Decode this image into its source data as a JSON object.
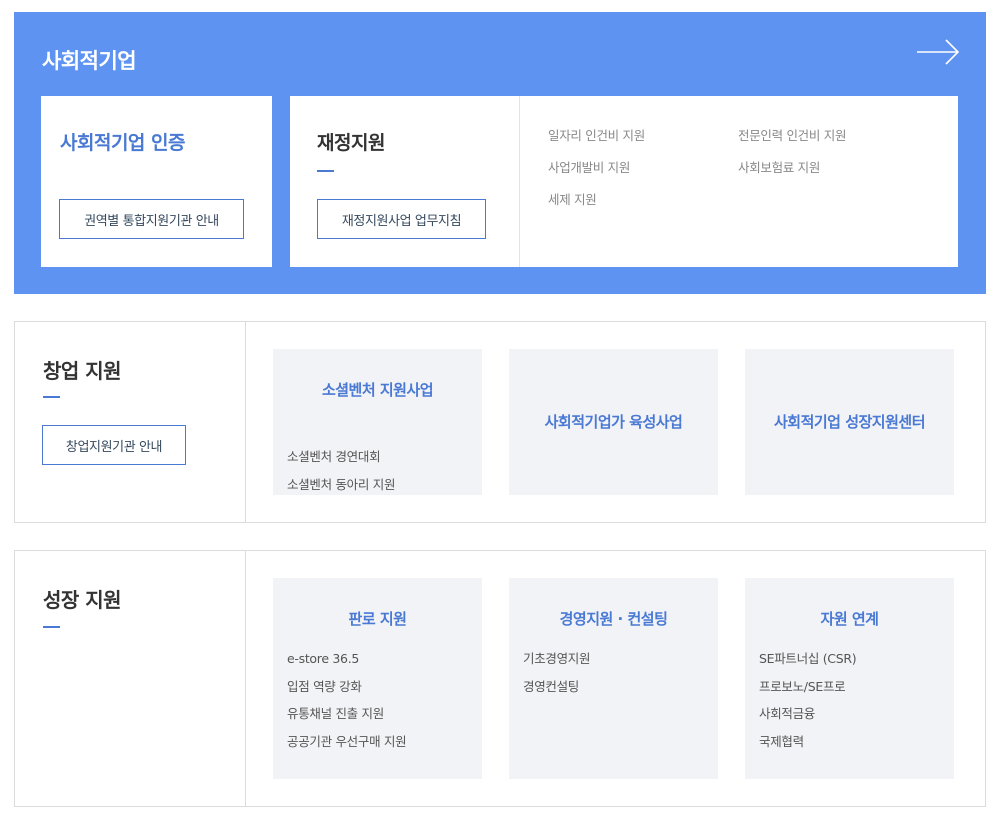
{
  "hero": {
    "title": "사회적기업",
    "cert_card": {
      "title": "사회적기업 인증",
      "button": "권역별 통합지원기관 안내"
    },
    "finance_card": {
      "title": "재정지원",
      "button": "재정지원사업 업무지침",
      "links": [
        "일자리 인건비 지원",
        "전문인력 인건비 지원",
        "사업개발비 지원",
        "사회보험료 지원",
        "세제 지원"
      ]
    }
  },
  "startup": {
    "title": "창업 지원",
    "button": "창업지원기관 안내",
    "boxes": [
      {
        "title": "소셜벤처 지원사업",
        "items": [
          "소셜벤처 경연대회",
          "소셜벤처 동아리 지원"
        ]
      },
      {
        "title": "사회적기업가 육성사업"
      },
      {
        "title": "사회적기업 성장지원센터"
      }
    ]
  },
  "growth": {
    "title": "성장 지원",
    "boxes": [
      {
        "title": "판로 지원",
        "items": [
          "e-store 36.5",
          "입점 역량 강화",
          "유통채널 진출 지원",
          "공공기관 우선구매 지원"
        ]
      },
      {
        "title": "경영지원 · 컨설팅",
        "items": [
          "기초경영지원",
          "경영컨설팅"
        ]
      },
      {
        "title": "자원 연계",
        "items": [
          "SE파트너십 (CSR)",
          "프로보노/SE프로",
          "사회적금융",
          "국제협력"
        ]
      }
    ]
  }
}
